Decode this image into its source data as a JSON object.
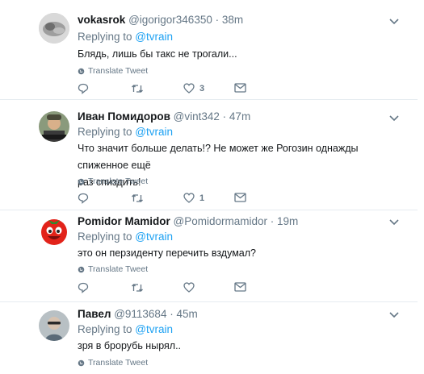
{
  "tweets": [
    {
      "name": "vokasrok",
      "handle": "@igorigor346350",
      "sep": " · ",
      "time": "38m",
      "reply_prefix": "Replying to ",
      "reply_to": "@tvrain",
      "text_lines": [
        "Блядь, лишь бы такс не трогали..."
      ],
      "translate": "Translate Tweet",
      "likes": "3",
      "avatar_color": "#cfcfcf"
    },
    {
      "name": "Иван Помидоров",
      "handle": "@vint342",
      "sep": " · ",
      "time": "47m",
      "reply_prefix": "Replying to ",
      "reply_to": "@tvrain",
      "text_lines": [
        "Что значит больше делать!? Не может же Рогозин однажды спиженное ещё",
        "раз спиздить!"
      ],
      "translate": "Translate Tweet",
      "likes": "1",
      "avatar_color": "#7a8a6a"
    },
    {
      "name": "Pomidor Mamidor",
      "handle": "@Pomidormamidor",
      "sep": " · ",
      "time": "19m",
      "reply_prefix": "Replying to ",
      "reply_to": "@tvrain",
      "text_lines": [
        "это он перзиденту перечить вздумал?"
      ],
      "translate": "Translate Tweet",
      "likes": "",
      "avatar_color": "#e2231a"
    },
    {
      "name": "Павел",
      "handle": "@9113684",
      "sep": " · ",
      "time": "45m",
      "reply_prefix": "Replying to ",
      "reply_to": "@tvrain",
      "text_lines": [
        "зря в брорубь нырял.."
      ],
      "translate": "Translate Tweet",
      "likes": "",
      "avatar_color": "#9aa3a8"
    }
  ],
  "colors": {
    "accent": "#1da1f2",
    "muted": "#657786",
    "divider": "#e6ecf0",
    "text": "#14171a"
  },
  "icons": [
    "reply-icon",
    "retweet-icon",
    "like-icon",
    "message-icon",
    "globe-icon",
    "chevron-down-icon"
  ]
}
